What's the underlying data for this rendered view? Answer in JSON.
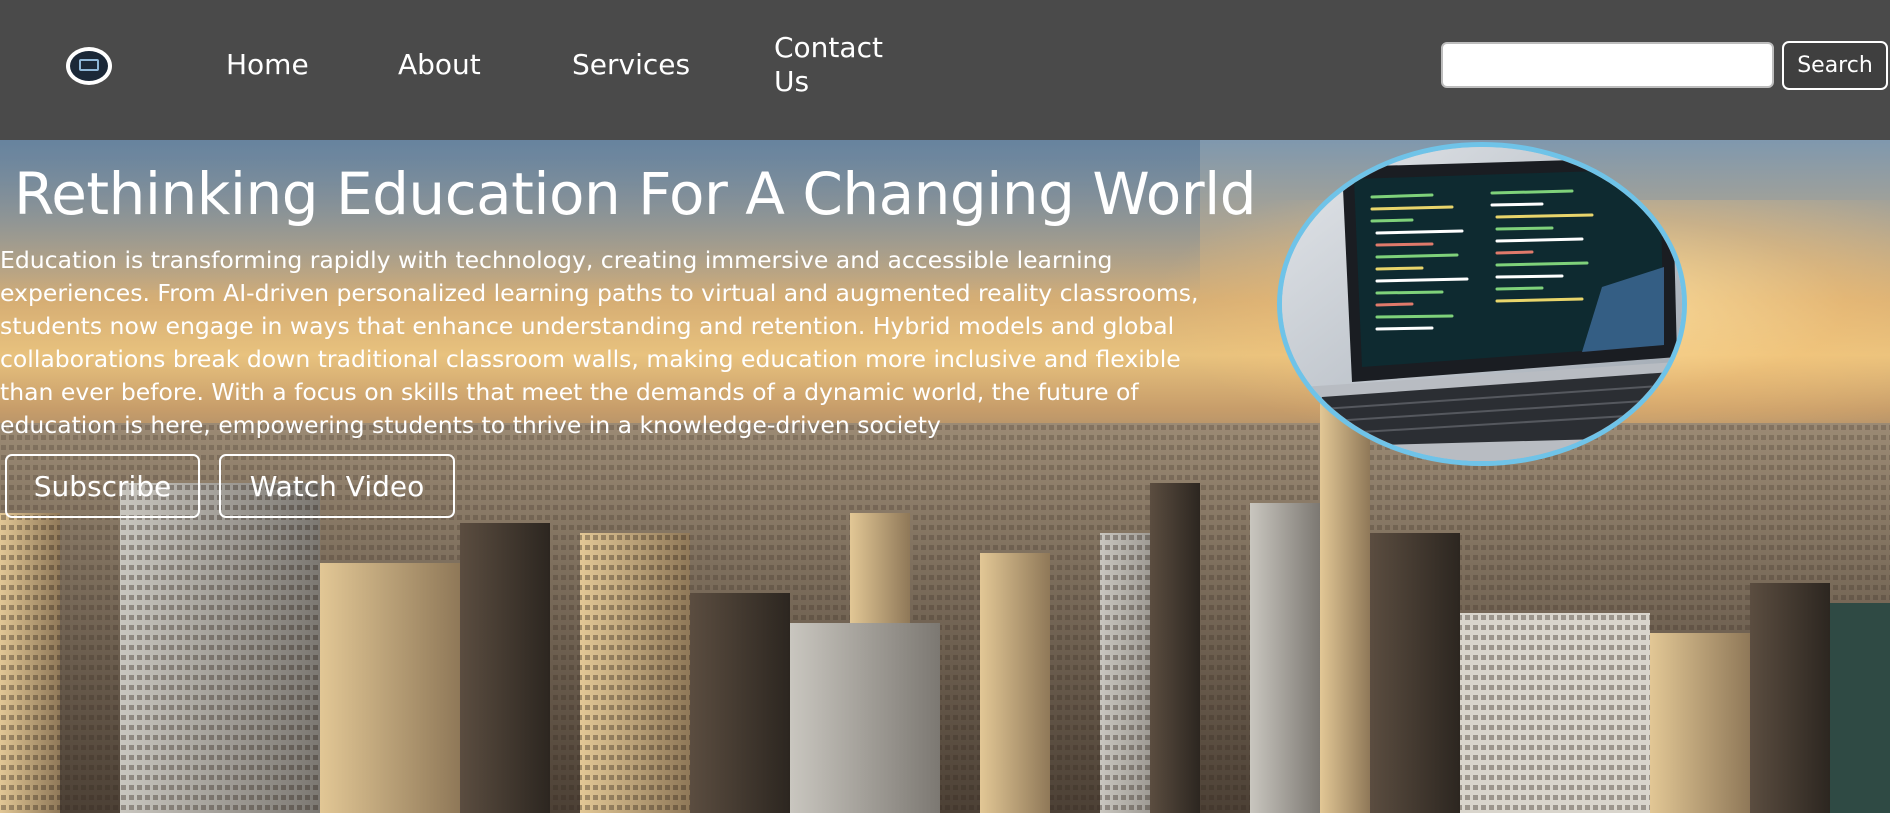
{
  "nav": {
    "logo_icon": "laptop-logo-icon",
    "links": [
      {
        "label": "Home"
      },
      {
        "label": "About"
      },
      {
        "label": "Services"
      },
      {
        "label": "Contact Us"
      }
    ],
    "search": {
      "value": "",
      "button_label": "Search"
    }
  },
  "hero": {
    "title": "Rethinking Education For A Changing World",
    "description": "Education is transforming rapidly with technology, creating immersive and accessible learning experiences. From AI-driven personalized learning paths to virtual and augmented reality classrooms, students now engage in ways that enhance understanding and retention. Hybrid models and global collaborations break down traditional classroom walls, making education more inclusive and flexible than ever before. With a focus on skills that meet the demands of a dynamic world, the future of education is here, empowering students to thrive in a knowledge-driven society",
    "buttons": {
      "subscribe": "Subscribe",
      "watch_video": "Watch Video"
    },
    "image_icon": "laptop-code-image",
    "background_icon": "city-skyline-image"
  },
  "colors": {
    "navbar": "#4a4a4a",
    "text": "#ffffff",
    "image_border": "#6fc3e8"
  }
}
